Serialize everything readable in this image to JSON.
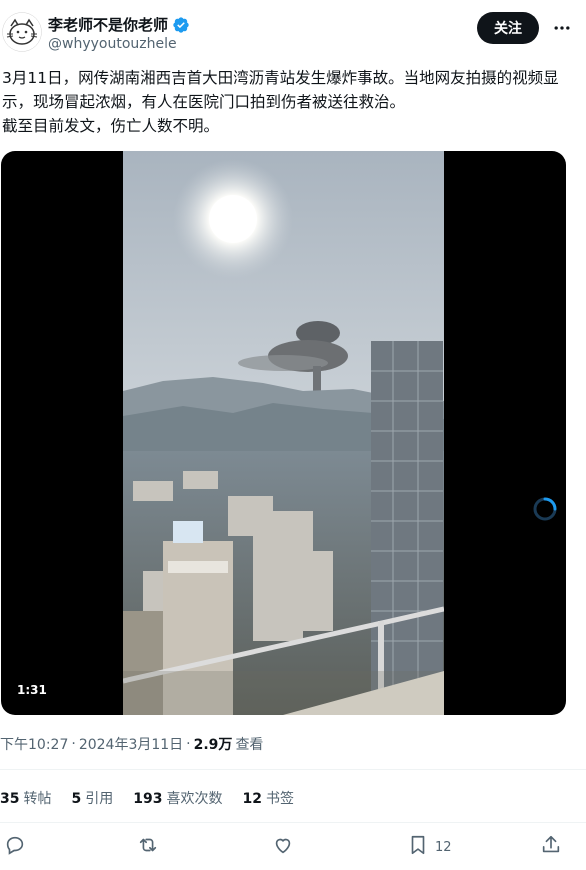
{
  "author": {
    "name": "李老师不是你老师",
    "handle": "@whyyoutouzhele",
    "verified_color": "#1d9bf0"
  },
  "follow_label": "关注",
  "tweet_text": "3月11日，网传湖南湘西吉首大田湾沥青站发生爆炸事故。当地网友拍摄的视频显示，现场冒起浓烟，有人在医院门口拍到伤者被送往救治。\n截至目前发文，伤亡人数不明。",
  "video": {
    "duration": "1:31"
  },
  "meta": {
    "time": "下午10:27",
    "date": "2024年3月11日",
    "views_count": "2.9万",
    "views_label": "查看",
    "separator": "·"
  },
  "stats": [
    {
      "count": "35",
      "label": "转帖"
    },
    {
      "count": "5",
      "label": "引用"
    },
    {
      "count": "193",
      "label": "喜欢次数"
    },
    {
      "count": "12",
      "label": "书签"
    }
  ],
  "actions": {
    "bookmark_count": "12"
  },
  "icons": {
    "reply": "reply-icon",
    "retweet": "retweet-icon",
    "like": "heart-icon",
    "bookmark": "bookmark-icon",
    "share": "share-icon",
    "more": "more-icon",
    "verified": "verified-badge-icon",
    "loading": "loading-spinner-icon"
  }
}
